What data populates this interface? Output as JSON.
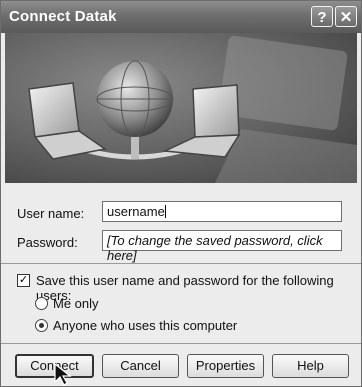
{
  "window": {
    "title": "Connect Datak",
    "help_glyph": "?",
    "close_glyph": "✕"
  },
  "form": {
    "username_label": "User name:",
    "username_value": "username",
    "password_label": "Password:",
    "password_value": "[To change the saved password, click here]",
    "save_label": "Save this user name and password for the following users:",
    "save_checked": true,
    "save_check_glyph": "✓",
    "options": [
      {
        "label": "Me only",
        "selected": false
      },
      {
        "label": "Anyone who uses this computer",
        "selected": true
      }
    ]
  },
  "buttons": {
    "connect": "Connect",
    "cancel": "Cancel",
    "properties": "Properties",
    "help": "Help"
  },
  "icons": [
    "help-icon",
    "close-icon",
    "globe-icon",
    "laptop-icon",
    "mouse-pointer-icon"
  ]
}
